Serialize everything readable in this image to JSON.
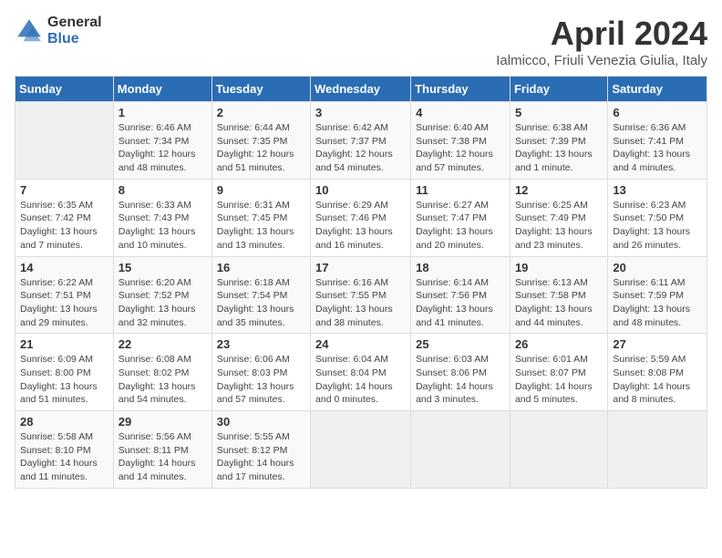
{
  "header": {
    "logo_general": "General",
    "logo_blue": "Blue",
    "title": "April 2024",
    "subtitle": "Ialmicco, Friuli Venezia Giulia, Italy"
  },
  "columns": [
    "Sunday",
    "Monday",
    "Tuesday",
    "Wednesday",
    "Thursday",
    "Friday",
    "Saturday"
  ],
  "weeks": [
    [
      {
        "day": "",
        "info": ""
      },
      {
        "day": "1",
        "info": "Sunrise: 6:46 AM\nSunset: 7:34 PM\nDaylight: 12 hours\nand 48 minutes."
      },
      {
        "day": "2",
        "info": "Sunrise: 6:44 AM\nSunset: 7:35 PM\nDaylight: 12 hours\nand 51 minutes."
      },
      {
        "day": "3",
        "info": "Sunrise: 6:42 AM\nSunset: 7:37 PM\nDaylight: 12 hours\nand 54 minutes."
      },
      {
        "day": "4",
        "info": "Sunrise: 6:40 AM\nSunset: 7:38 PM\nDaylight: 12 hours\nand 57 minutes."
      },
      {
        "day": "5",
        "info": "Sunrise: 6:38 AM\nSunset: 7:39 PM\nDaylight: 13 hours\nand 1 minute."
      },
      {
        "day": "6",
        "info": "Sunrise: 6:36 AM\nSunset: 7:41 PM\nDaylight: 13 hours\nand 4 minutes."
      }
    ],
    [
      {
        "day": "7",
        "info": "Sunrise: 6:35 AM\nSunset: 7:42 PM\nDaylight: 13 hours\nand 7 minutes."
      },
      {
        "day": "8",
        "info": "Sunrise: 6:33 AM\nSunset: 7:43 PM\nDaylight: 13 hours\nand 10 minutes."
      },
      {
        "day": "9",
        "info": "Sunrise: 6:31 AM\nSunset: 7:45 PM\nDaylight: 13 hours\nand 13 minutes."
      },
      {
        "day": "10",
        "info": "Sunrise: 6:29 AM\nSunset: 7:46 PM\nDaylight: 13 hours\nand 16 minutes."
      },
      {
        "day": "11",
        "info": "Sunrise: 6:27 AM\nSunset: 7:47 PM\nDaylight: 13 hours\nand 20 minutes."
      },
      {
        "day": "12",
        "info": "Sunrise: 6:25 AM\nSunset: 7:49 PM\nDaylight: 13 hours\nand 23 minutes."
      },
      {
        "day": "13",
        "info": "Sunrise: 6:23 AM\nSunset: 7:50 PM\nDaylight: 13 hours\nand 26 minutes."
      }
    ],
    [
      {
        "day": "14",
        "info": "Sunrise: 6:22 AM\nSunset: 7:51 PM\nDaylight: 13 hours\nand 29 minutes."
      },
      {
        "day": "15",
        "info": "Sunrise: 6:20 AM\nSunset: 7:52 PM\nDaylight: 13 hours\nand 32 minutes."
      },
      {
        "day": "16",
        "info": "Sunrise: 6:18 AM\nSunset: 7:54 PM\nDaylight: 13 hours\nand 35 minutes."
      },
      {
        "day": "17",
        "info": "Sunrise: 6:16 AM\nSunset: 7:55 PM\nDaylight: 13 hours\nand 38 minutes."
      },
      {
        "day": "18",
        "info": "Sunrise: 6:14 AM\nSunset: 7:56 PM\nDaylight: 13 hours\nand 41 minutes."
      },
      {
        "day": "19",
        "info": "Sunrise: 6:13 AM\nSunset: 7:58 PM\nDaylight: 13 hours\nand 44 minutes."
      },
      {
        "day": "20",
        "info": "Sunrise: 6:11 AM\nSunset: 7:59 PM\nDaylight: 13 hours\nand 48 minutes."
      }
    ],
    [
      {
        "day": "21",
        "info": "Sunrise: 6:09 AM\nSunset: 8:00 PM\nDaylight: 13 hours\nand 51 minutes."
      },
      {
        "day": "22",
        "info": "Sunrise: 6:08 AM\nSunset: 8:02 PM\nDaylight: 13 hours\nand 54 minutes."
      },
      {
        "day": "23",
        "info": "Sunrise: 6:06 AM\nSunset: 8:03 PM\nDaylight: 13 hours\nand 57 minutes."
      },
      {
        "day": "24",
        "info": "Sunrise: 6:04 AM\nSunset: 8:04 PM\nDaylight: 14 hours\nand 0 minutes."
      },
      {
        "day": "25",
        "info": "Sunrise: 6:03 AM\nSunset: 8:06 PM\nDaylight: 14 hours\nand 3 minutes."
      },
      {
        "day": "26",
        "info": "Sunrise: 6:01 AM\nSunset: 8:07 PM\nDaylight: 14 hours\nand 5 minutes."
      },
      {
        "day": "27",
        "info": "Sunrise: 5:59 AM\nSunset: 8:08 PM\nDaylight: 14 hours\nand 8 minutes."
      }
    ],
    [
      {
        "day": "28",
        "info": "Sunrise: 5:58 AM\nSunset: 8:10 PM\nDaylight: 14 hours\nand 11 minutes."
      },
      {
        "day": "29",
        "info": "Sunrise: 5:56 AM\nSunset: 8:11 PM\nDaylight: 14 hours\nand 14 minutes."
      },
      {
        "day": "30",
        "info": "Sunrise: 5:55 AM\nSunset: 8:12 PM\nDaylight: 14 hours\nand 17 minutes."
      },
      {
        "day": "",
        "info": ""
      },
      {
        "day": "",
        "info": ""
      },
      {
        "day": "",
        "info": ""
      },
      {
        "day": "",
        "info": ""
      }
    ]
  ]
}
